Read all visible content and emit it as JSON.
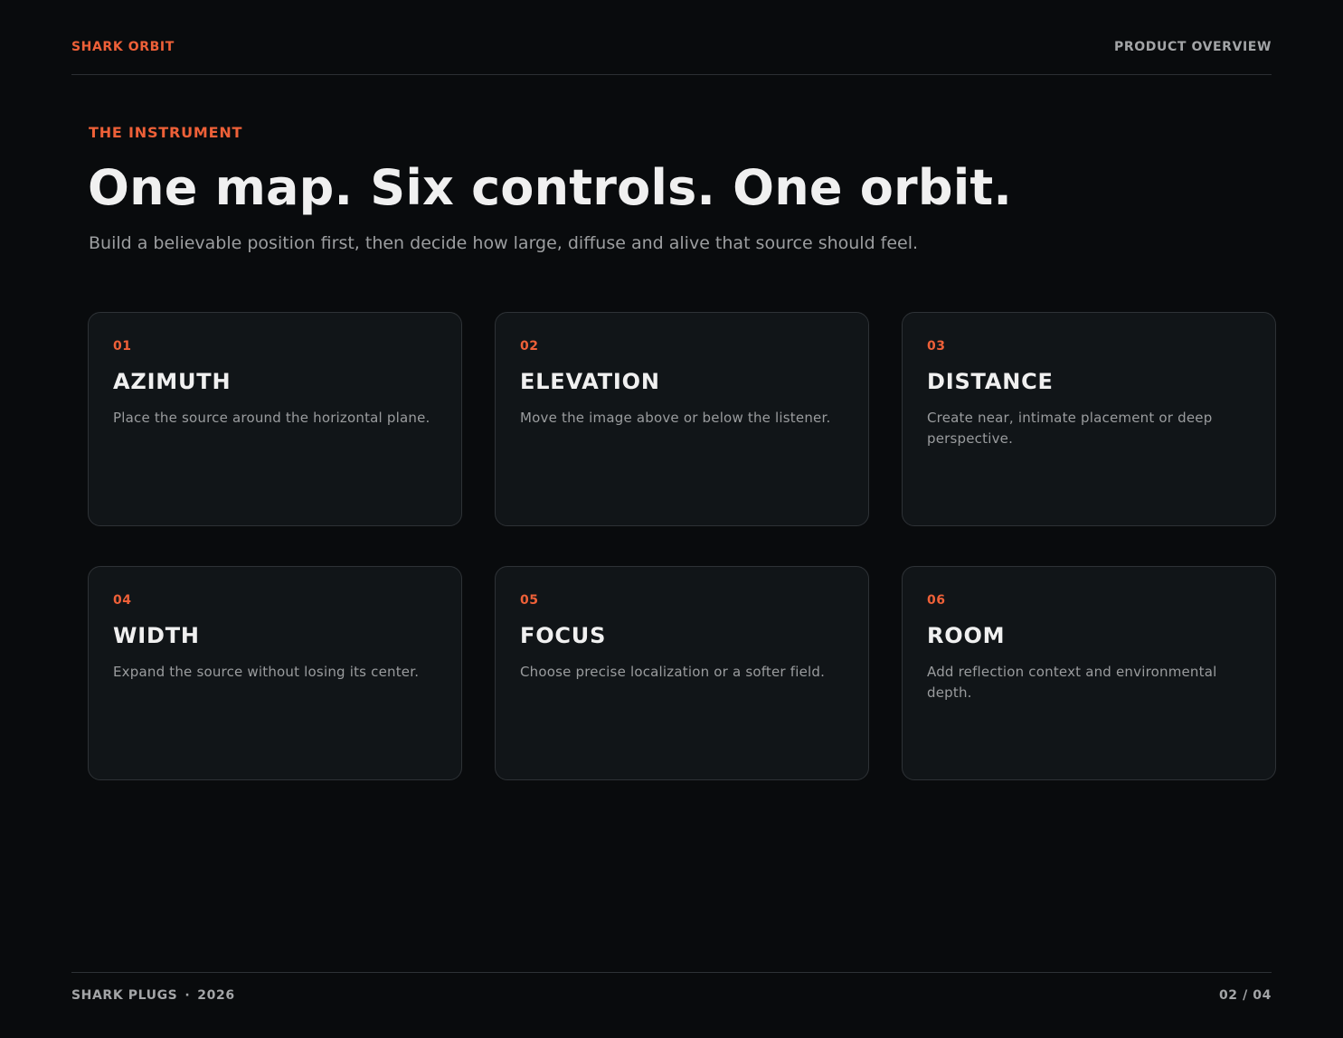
{
  "header": {
    "brand": "SHARK ORBIT",
    "section": "PRODUCT OVERVIEW"
  },
  "intro": {
    "eyebrow": "THE INSTRUMENT",
    "headline": "One map. Six controls. One orbit.",
    "subtitle": "Build a believable position first, then decide how large, diffuse and alive that source should feel."
  },
  "cards": [
    {
      "num": "01",
      "title": "AZIMUTH",
      "desc": "Place the source around the horizontal plane."
    },
    {
      "num": "02",
      "title": "ELEVATION",
      "desc": "Move the image above or below the listener."
    },
    {
      "num": "03",
      "title": "DISTANCE",
      "desc": "Create near, intimate placement or deep perspective."
    },
    {
      "num": "04",
      "title": "WIDTH",
      "desc": "Expand the source without losing its center."
    },
    {
      "num": "05",
      "title": "FOCUS",
      "desc": "Choose precise localization or a softer field."
    },
    {
      "num": "06",
      "title": "ROOM",
      "desc": "Add reflection context and environmental depth."
    }
  ],
  "footer": {
    "company": "SHARK PLUGS",
    "separator": "·",
    "year": "2026",
    "page": "02 / 04"
  },
  "colors": {
    "accent": "#ee6038",
    "background": "#090b0d",
    "card": "#111518"
  }
}
